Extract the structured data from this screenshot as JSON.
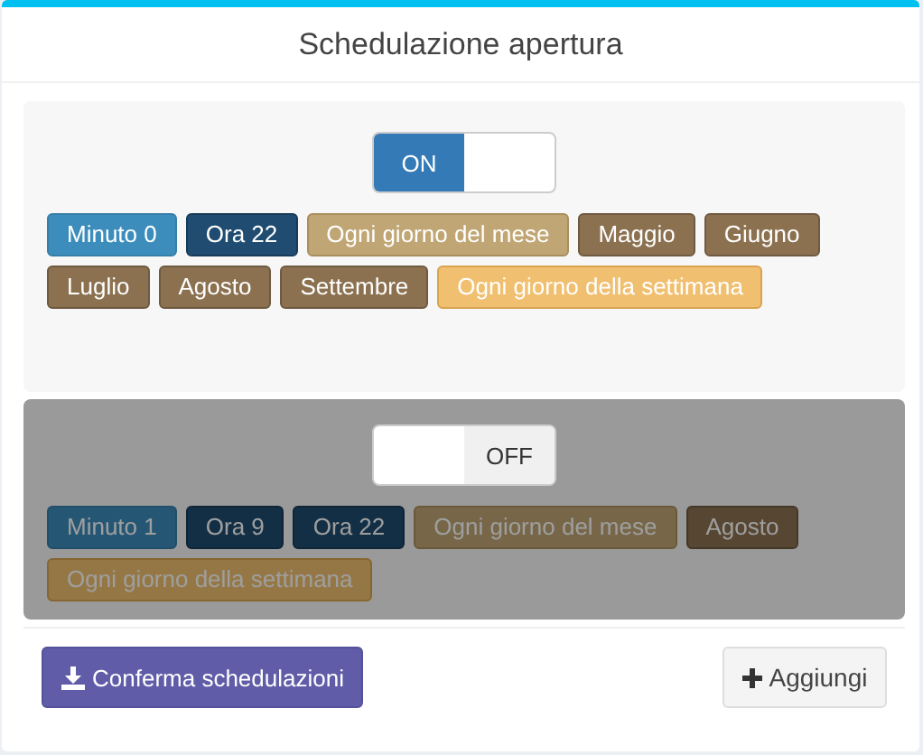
{
  "card": {
    "title": "Schedulazione apertura"
  },
  "schedules": [
    {
      "on": true,
      "toggle_label": "ON",
      "tags": [
        {
          "kind": "minute",
          "label": "Minuto 0"
        },
        {
          "kind": "hour",
          "label": "Ora 22"
        },
        {
          "kind": "monthday",
          "label": "Ogni giorno del mese"
        },
        {
          "kind": "month",
          "label": "Maggio"
        },
        {
          "kind": "month",
          "label": "Giugno"
        },
        {
          "kind": "month",
          "label": "Luglio"
        },
        {
          "kind": "month",
          "label": "Agosto"
        },
        {
          "kind": "month",
          "label": "Settembre"
        },
        {
          "kind": "weekday",
          "label": "Ogni giorno della settimana"
        }
      ]
    },
    {
      "on": false,
      "toggle_label": "OFF",
      "tags": [
        {
          "kind": "minute",
          "label": "Minuto 1"
        },
        {
          "kind": "hour",
          "label": "Ora 9"
        },
        {
          "kind": "hour",
          "label": "Ora 22"
        },
        {
          "kind": "monthday",
          "label": "Ogni giorno del mese"
        },
        {
          "kind": "month",
          "label": "Agosto"
        },
        {
          "kind": "weekday",
          "label": "Ogni giorno della settimana"
        }
      ]
    }
  ],
  "buttons": {
    "confirm": "Conferma schedulazioni",
    "add": "Aggiungi"
  }
}
